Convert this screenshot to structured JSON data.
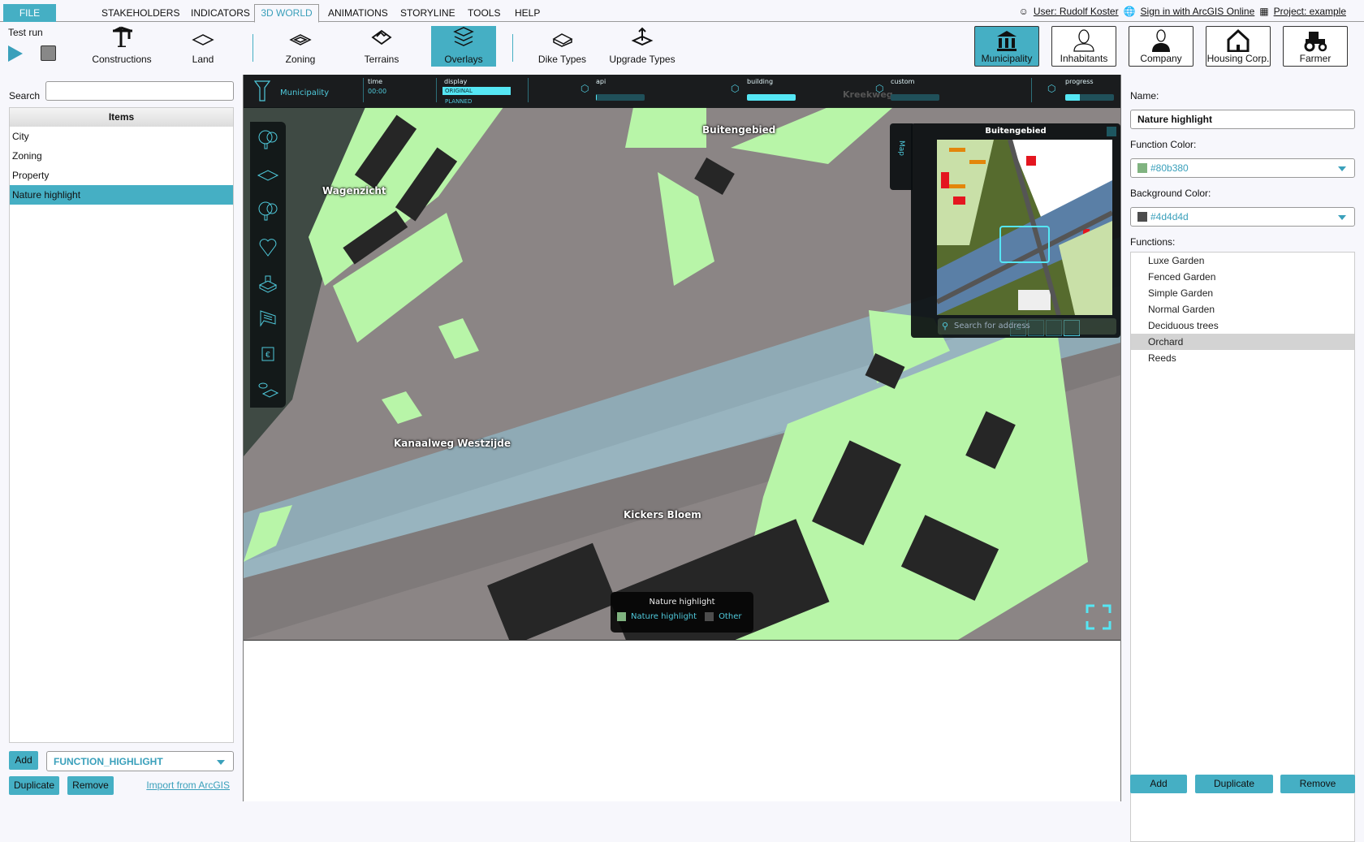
{
  "menubar": {
    "file": "FILE",
    "tabs": [
      "STAKEHOLDERS",
      "INDICATORS",
      "3D WORLD",
      "ANIMATIONS",
      "STORYLINE",
      "TOOLS",
      "HELP"
    ],
    "active_tab": "3D WORLD",
    "user": "User: Rudolf Koster",
    "arcgis": "Sign in with ArcGIS Online",
    "project": "Project: example"
  },
  "toolbar": {
    "test_run": "Test run",
    "tools": [
      {
        "label": "Constructions",
        "icon": "crane-icon"
      },
      {
        "label": "Land",
        "icon": "land-icon"
      },
      {
        "label": "Zoning",
        "icon": "zoning-icon"
      },
      {
        "label": "Terrains",
        "icon": "terrain-icon"
      },
      {
        "label": "Overlays",
        "icon": "layers-icon",
        "active": true
      },
      {
        "label": "Dike Types",
        "icon": "dike-icon"
      },
      {
        "label": "Upgrade Types",
        "icon": "upgrade-icon"
      }
    ],
    "stakeholders": [
      {
        "label": "Municipality",
        "icon": "government-building-icon",
        "active": true
      },
      {
        "label": "Inhabitants",
        "icon": "person-icon"
      },
      {
        "label": "Company",
        "icon": "businessman-icon"
      },
      {
        "label": "Housing Corp.",
        "icon": "house-icon"
      },
      {
        "label": "Farmer",
        "icon": "tractor-icon"
      }
    ]
  },
  "left": {
    "search_label": "Search",
    "search_value": "",
    "list_header": "Items",
    "items": [
      "City",
      "Zoning",
      "Property",
      "Nature highlight"
    ],
    "selected": "Nature highlight",
    "add": "Add",
    "type_select": "FUNCTION_HIGHLIGHT",
    "duplicate": "Duplicate",
    "remove": "Remove",
    "import": "Import from ArcGIS"
  },
  "hud": {
    "stakeholder": "Municipality",
    "time_label": "time",
    "time_value": "00:00",
    "display_label": "display",
    "display_original": "ORIGINAL",
    "display_planned": "PLANNED",
    "api_label": "api",
    "api_progress": 0.02,
    "building_label": "building",
    "building_progress": 1.0,
    "custom_label": "custom",
    "custom_progress": 0.0,
    "progress_label": "progress",
    "progress_value": 0.3
  },
  "map": {
    "labels": [
      "Buitengebied",
      "Wagenzicht",
      "Kanaalweg Westzijde",
      "Kickers Bloem",
      "Kreekweg"
    ],
    "minimap_title": "Buitengebied",
    "minimap_tab": "Map",
    "address_placeholder": "Search for address",
    "legend": {
      "title": "Nature highlight",
      "entries": [
        {
          "label": "Nature highlight",
          "color": "#80b380"
        },
        {
          "label": "Other",
          "color": "#4d4d4d"
        }
      ]
    }
  },
  "right": {
    "name_label": "Name:",
    "name_value": "Nature highlight",
    "function_color_label": "Function Color:",
    "function_color": "#80b380",
    "background_color_label": "Background Color:",
    "background_color": "#4d4d4d",
    "functions_label": "Functions:",
    "functions": [
      "Luxe Garden",
      "Fenced Garden",
      "Simple Garden",
      "Normal Garden",
      "Deciduous trees",
      "Orchard",
      "Reeds"
    ],
    "selected_function": "Orchard",
    "add": "Add",
    "duplicate": "Duplicate",
    "remove": "Remove"
  },
  "colors": {
    "accent": "#45afc4",
    "hud_cyan": "#55e6f4",
    "nature_green": "#b8f5a8"
  }
}
